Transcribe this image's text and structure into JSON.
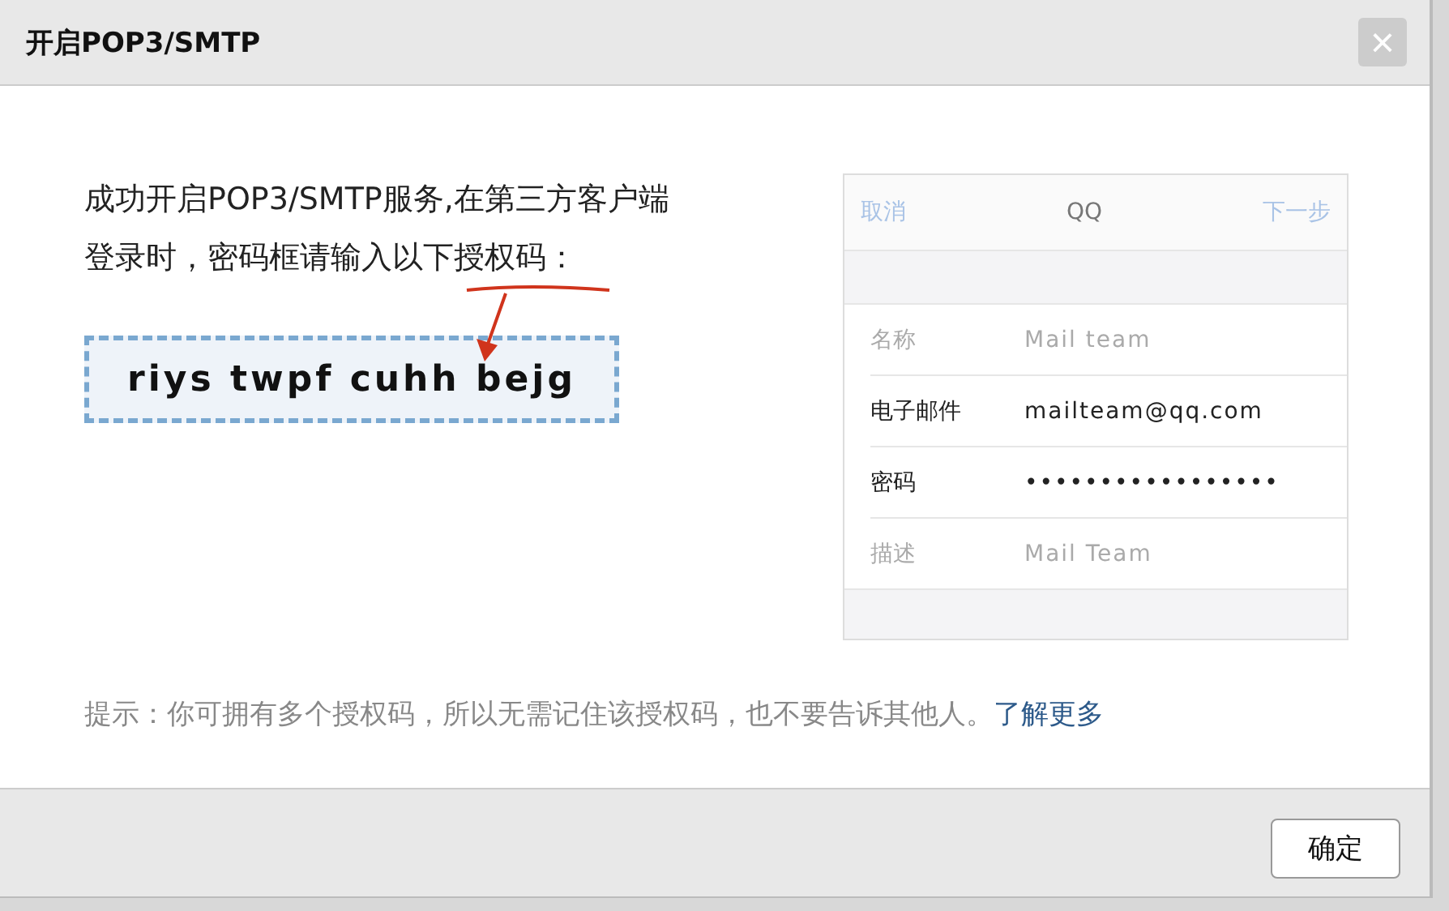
{
  "dialog": {
    "title": "开启POP3/SMTP",
    "close": "×",
    "message": "成功开启POP3/SMTP服务,在第三方客户端登录时，密码框请输入以下授权码：",
    "auth_code": "riys twpf cuhh bejg",
    "phone_example": {
      "cancel": "取消",
      "title": "QQ",
      "next": "下一步",
      "rows": [
        {
          "label": "名称",
          "value": "Mail team",
          "emphasized": false
        },
        {
          "label": "电子邮件",
          "value": "mailteam@qq.com",
          "emphasized": true
        },
        {
          "label": "密码",
          "value": "•••••••••••••••••",
          "emphasized": true
        },
        {
          "label": "描述",
          "value": "Mail Team",
          "emphasized": false
        }
      ]
    },
    "tip": "提示：你可拥有多个授权码，所以无需记住该授权码，也不要告诉其他人。",
    "tip_link": "了解更多",
    "buttons": [
      "确定"
    ]
  }
}
